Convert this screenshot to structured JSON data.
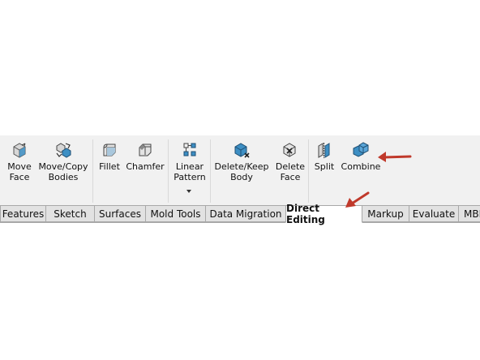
{
  "ribbon": {
    "commands": [
      {
        "label": "Move\nFace",
        "icon": "move-face-icon"
      },
      {
        "label": "Move/Copy\nBodies",
        "icon": "move-copy-bodies-icon"
      },
      {
        "label": "Fillet",
        "icon": "fillet-icon"
      },
      {
        "label": "Chamfer",
        "icon": "chamfer-icon"
      },
      {
        "label": "Linear\nPattern",
        "icon": "linear-pattern-icon"
      },
      {
        "label": "Delete/Keep\nBody",
        "icon": "delete-keep-body-icon"
      },
      {
        "label": "Delete\nFace",
        "icon": "delete-face-icon"
      },
      {
        "label": "Split",
        "icon": "split-icon"
      },
      {
        "label": "Combine",
        "icon": "combine-icon"
      }
    ]
  },
  "tabs": [
    {
      "label": "Features"
    },
    {
      "label": "Sketch"
    },
    {
      "label": "Surfaces"
    },
    {
      "label": "Mold Tools"
    },
    {
      "label": "Data Migration"
    },
    {
      "label": "Direct Editing",
      "active": true
    },
    {
      "label": "Markup"
    },
    {
      "label": "Evaluate"
    },
    {
      "label": "MBD"
    }
  ],
  "colors": {
    "ribbon_bg": "#f1f1f1",
    "icon_blue": "#3d8fc4",
    "icon_gray": "#8a8a8a",
    "annotation_arrow": "#c0392b"
  }
}
